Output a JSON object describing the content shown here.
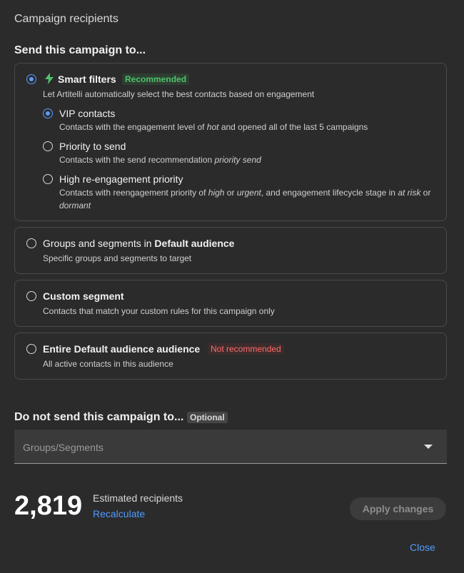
{
  "dialog": {
    "title": "Campaign recipients",
    "send_heading": "Send this campaign to...",
    "smart": {
      "label": "Smart filters",
      "badge": "Recommended",
      "desc": "Let Artitelli automatically select the best contacts based on engagement",
      "options": [
        {
          "label": "VIP contacts",
          "desc_pre": "Contacts with the engagement level of ",
          "desc_em1": "hot",
          "desc_mid": " and opened all of the last 5 campaigns",
          "checked": true
        },
        {
          "label": "Priority to send",
          "desc_pre": "Contacts with the send recommendation ",
          "desc_em1": "priority send",
          "checked": false
        },
        {
          "label": "High re-engagement priority",
          "desc_pre": "Contacts with reengagement priority of ",
          "desc_em1": "high",
          "desc_mid": " or ",
          "desc_em2": "urgent",
          "desc_mid2": ", and engagement lifecycle stage in ",
          "desc_em3": "at risk",
          "desc_mid3": " or ",
          "desc_em4": "dormant",
          "checked": false
        }
      ]
    },
    "groups": {
      "label_pre": "Groups and segments in ",
      "label_bold": "Default audience",
      "desc": "Specific groups and segments to target"
    },
    "custom": {
      "label": "Custom segment",
      "desc": "Contacts that match your custom rules for this campaign only"
    },
    "entire": {
      "label_pre": "Entire ",
      "label_bold": "Default audience",
      "label_post": " audience",
      "badge": "Not recommended",
      "desc": "All active contacts in this audience"
    },
    "exclude": {
      "heading": "Do not send this campaign to...",
      "badge": "Optional",
      "placeholder": "Groups/Segments"
    },
    "estimate": {
      "count": "2,819",
      "label": "Estimated recipients",
      "recalculate": "Recalculate"
    },
    "apply_label": "Apply changes",
    "close_label": "Close"
  },
  "colors": {
    "accent": "#5b9bff",
    "link": "#4f9bff",
    "recommended": "#4fc36a",
    "not_recommended": "#ff6b6b"
  }
}
